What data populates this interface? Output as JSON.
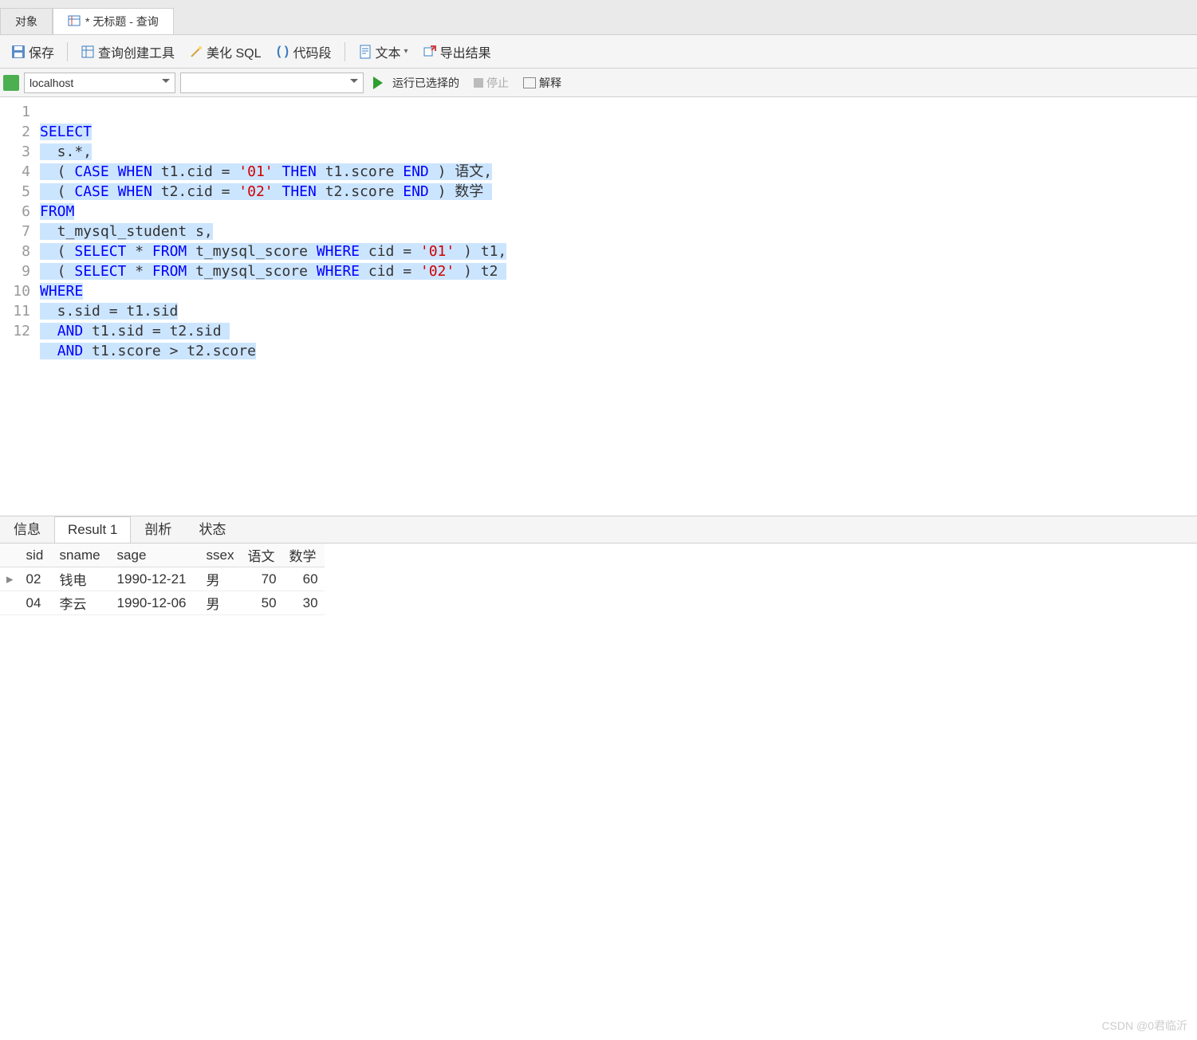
{
  "tabs": {
    "objects": "对象",
    "query_title": "* 无标题 - 查询"
  },
  "toolbar": {
    "save": "保存",
    "query_builder": "查询创建工具",
    "beautify": "美化 SQL",
    "snippet": "代码段",
    "text": "文本",
    "export": "导出结果"
  },
  "connbar": {
    "connection": "localhost",
    "db": "",
    "run": "运行已选择的",
    "stop": "停止",
    "explain": "解释"
  },
  "code": {
    "lines": [
      "1",
      "2",
      "3",
      "4",
      "5",
      "6",
      "7",
      "8",
      "9",
      "10",
      "11",
      "12"
    ]
  },
  "sql_tokens": {
    "l1_a": "SELECT",
    "l2_a": "  s.*,",
    "l3_a": "  ( ",
    "l3_kw1": "CASE",
    "l3_b": " ",
    "l3_kw2": "WHEN",
    "l3_c": " t1.cid = ",
    "l3_s1": "'01'",
    "l3_d": " ",
    "l3_kw3": "THEN",
    "l3_e": " t1.score ",
    "l3_kw4": "END",
    "l3_f": " ) 语文,",
    "l4_a": "  ( ",
    "l4_kw1": "CASE",
    "l4_b": " ",
    "l4_kw2": "WHEN",
    "l4_c": " t2.cid = ",
    "l4_s1": "'02'",
    "l4_d": " ",
    "l4_kw3": "THEN",
    "l4_e": " t2.score ",
    "l4_kw4": "END",
    "l4_f": " ) 数学 ",
    "l5_a": "FROM",
    "l6_a": "  t_mysql_student s,",
    "l7_a": "  ( ",
    "l7_kw1": "SELECT",
    "l7_b": " * ",
    "l7_kw2": "FROM",
    "l7_c": " t_mysql_score ",
    "l7_kw3": "WHERE",
    "l7_d": " cid = ",
    "l7_s1": "'01'",
    "l7_e": " ) t1,",
    "l8_a": "  ( ",
    "l8_kw1": "SELECT",
    "l8_b": " * ",
    "l8_kw2": "FROM",
    "l8_c": " t_mysql_score ",
    "l8_kw3": "WHERE",
    "l8_d": " cid = ",
    "l8_s1": "'02'",
    "l8_e": " ) t2 ",
    "l9_a": "WHERE",
    "l10_a": "  s.sid = t1.sid",
    "l11_a": "  ",
    "l11_kw1": "AND",
    "l11_b": " t1.sid = t2.sid ",
    "l12_a": "  ",
    "l12_kw1": "AND",
    "l12_b": " t1.score > t2.score"
  },
  "result_tabs": {
    "info": "信息",
    "result1": "Result 1",
    "profile": "剖析",
    "status": "状态"
  },
  "grid": {
    "headers": {
      "sid": "sid",
      "sname": "sname",
      "sage": "sage",
      "ssex": "ssex",
      "yuwen": "语文",
      "shuxue": "数学"
    },
    "rows": [
      {
        "sid": "02",
        "sname": "钱电",
        "sage": "1990-12-21",
        "ssex": "男",
        "yuwen": "70",
        "shuxue": "60"
      },
      {
        "sid": "04",
        "sname": "李云",
        "sage": "1990-12-06",
        "ssex": "男",
        "yuwen": "50",
        "shuxue": "30"
      }
    ]
  },
  "watermark": "CSDN @0君临沂"
}
